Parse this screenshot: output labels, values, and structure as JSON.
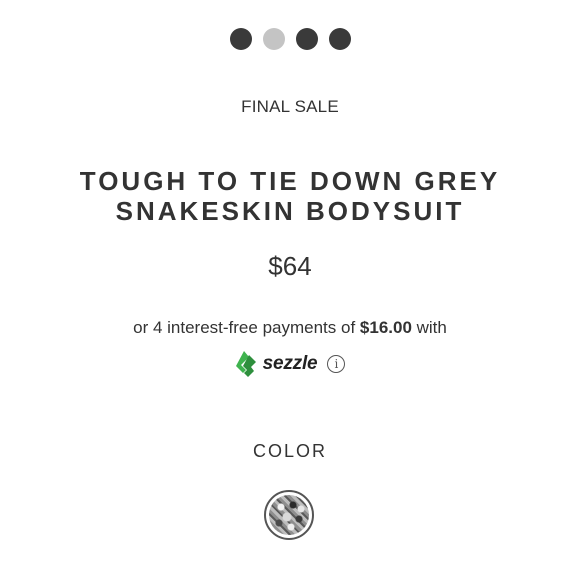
{
  "carousel": {
    "slides": [
      {
        "active": true
      },
      {
        "active": false
      },
      {
        "active": true
      },
      {
        "active": true
      }
    ]
  },
  "product": {
    "badge": "FINAL SALE",
    "title_line1": "TOUGH TO TIE DOWN GREY",
    "title_line2": "SNAKESKIN BODYSUIT",
    "price": "$64"
  },
  "financing": {
    "prefix": "or 4 interest-free payments of ",
    "amount": "$16.00",
    "suffix": " with",
    "provider": "sezzle",
    "provider_icon": "sezzle-logo-icon",
    "info_icon": "info-icon"
  },
  "options": {
    "color_label": "COLOR",
    "swatch_name": "snakeskin-swatch"
  },
  "colors": {
    "text": "#333333",
    "dot_active": "#3a3a3a",
    "dot_inactive": "#c4c4c4",
    "sezzle_green": "#3fb34f"
  }
}
